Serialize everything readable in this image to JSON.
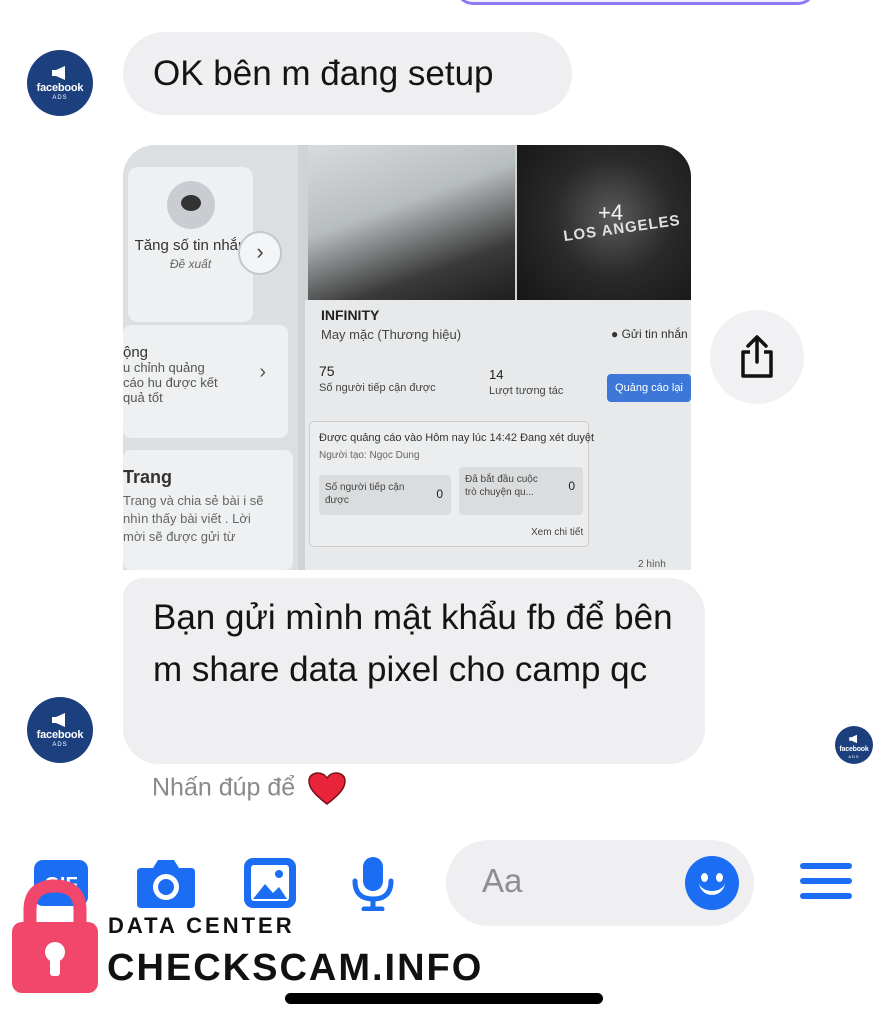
{
  "conversation": {
    "sender": {
      "avatar_brand": "facebook",
      "avatar_sub": "ADS"
    },
    "messages": [
      {
        "text": "OK bên m đang setup"
      },
      {
        "text": "Bạn gửi mình mật khẩu fb để bên m share data pixel cho camp qc"
      }
    ],
    "double_tap_hint": "Nhấn đúp để",
    "double_tap_emoji": "❤️"
  },
  "shared_photo": {
    "card_title": "Tăng số tin nhắn",
    "card_note": "Đề xuất",
    "card2_title": "ộng",
    "card2_text": "u chỉnh quảng cáo hu được kết quả tốt",
    "card3_title": "Trang",
    "card3_text": "Trang và chia sẻ bài i sẽ nhìn thấy bài viết . Lời mời sẽ được gửi từ",
    "plus_more": "+4",
    "shirt_text": "LOS ANGELES",
    "page_name": "INFINITY",
    "page_category": "May mặc (Thương hiệu)",
    "send_message": "Gửi tin nhắn",
    "reach_count": "75",
    "reach_label": "Số người tiếp cận được",
    "engagement_count": "14",
    "engagement_label": "Lượt tương tác",
    "boost_again": "Quảng cáo lại",
    "ad_status": "Được quảng cáo vào Hôm nay lúc 14:42 Đang xét duyệt",
    "creator": "Người tạo: Ngọc Dung",
    "metric1_label": "Số người tiếp cận được",
    "metric1_value": "0",
    "metric2_label": "Đã bắt đầu cuộc trò chuyện qu...",
    "metric2_value": "0",
    "see_details": "Xem chi tiết",
    "time_info": "2 hình"
  },
  "composer": {
    "placeholder": "Aa"
  },
  "watermark": {
    "line1": "DATA CENTER",
    "line2": "CHECKSCAM.INFO"
  },
  "colors": {
    "accent": "#1b6ef3",
    "bubble": "#efeff1",
    "watermark_lock": "#f0476b",
    "avatar": "#1c3f7e"
  },
  "icons": [
    "gif-icon",
    "camera-icon",
    "gallery-icon",
    "microphone-icon",
    "emoji-icon",
    "menu-icon",
    "share-icon",
    "lock-icon",
    "heart-emoji"
  ]
}
